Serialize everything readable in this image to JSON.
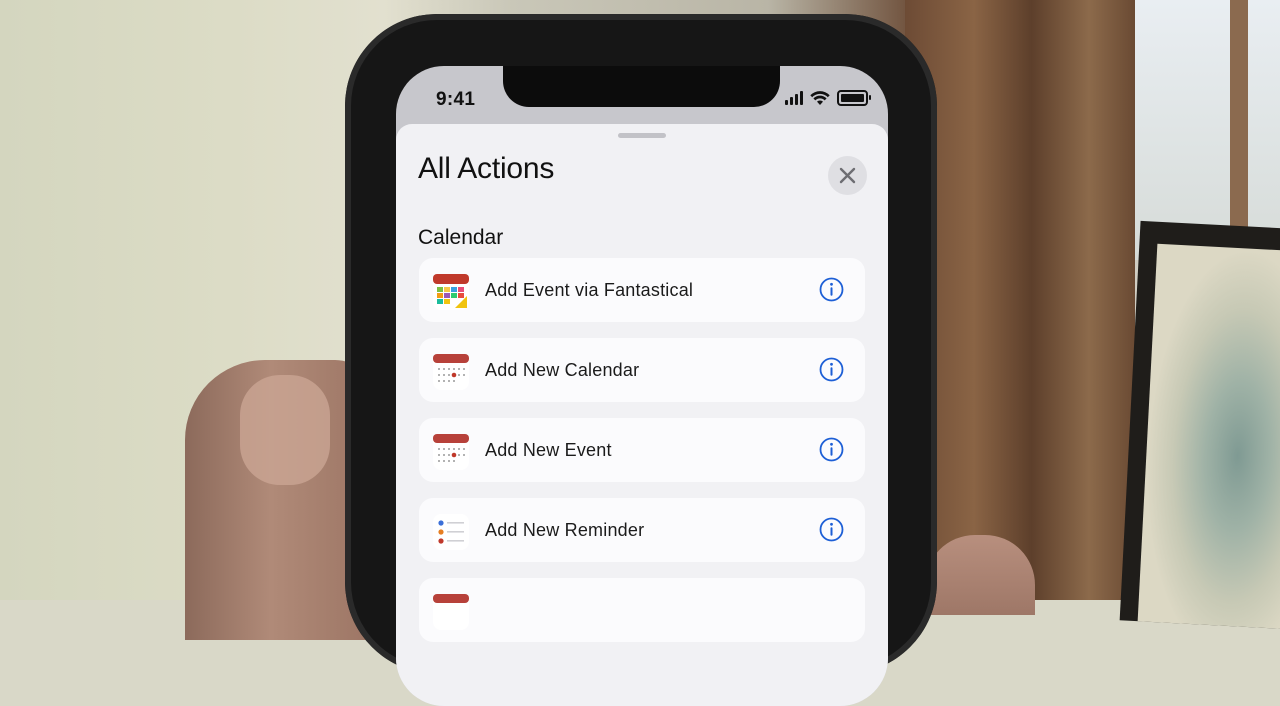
{
  "status_bar": {
    "time": "9:41"
  },
  "sheet": {
    "title": "All Actions",
    "section": "Calendar",
    "actions": [
      {
        "label": "Add Event via Fantastical",
        "icon": "fantastical-icon"
      },
      {
        "label": "Add New Calendar",
        "icon": "calendar-app-icon"
      },
      {
        "label": "Add New Event",
        "icon": "calendar-app-icon"
      },
      {
        "label": "Add New Reminder",
        "icon": "reminders-app-icon"
      },
      {
        "label": "",
        "icon": "calendar-app-icon"
      }
    ]
  },
  "colors": {
    "accent": "#1d5fd6",
    "calendar_red": "#c0392b",
    "sheet_bg": "#f1f1f4"
  }
}
